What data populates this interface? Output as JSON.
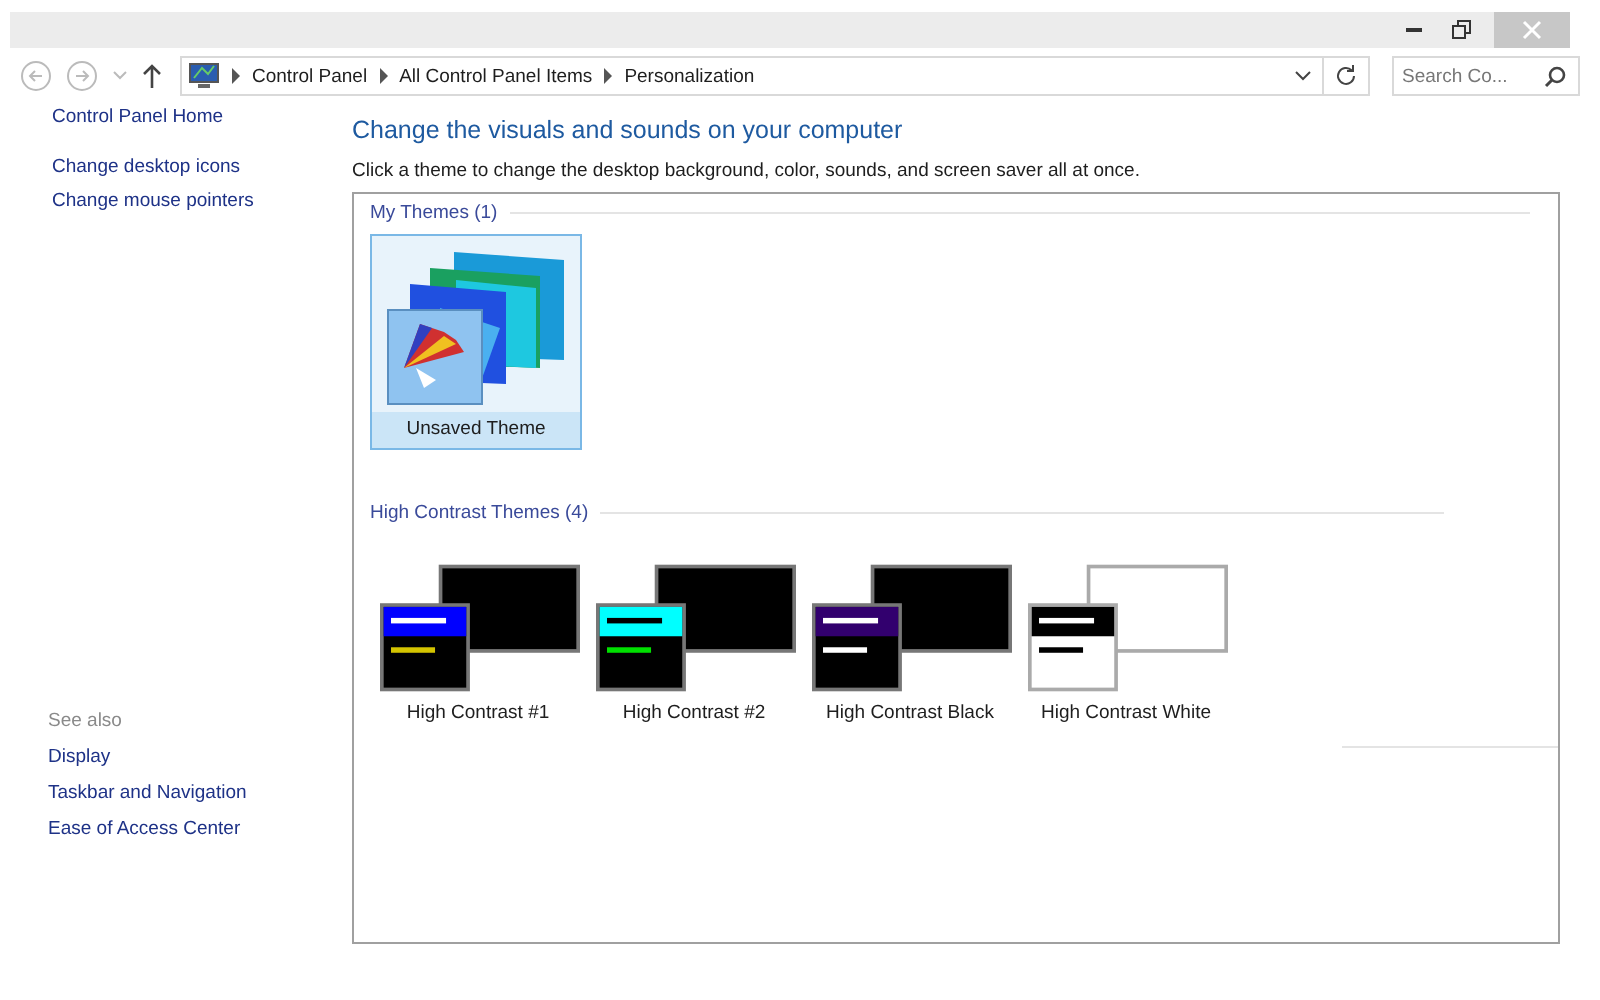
{
  "address_bar": {
    "breadcrumbs": [
      "Control Panel",
      "All Control Panel Items",
      "Personalization"
    ]
  },
  "search": {
    "placeholder": "Search Co..."
  },
  "sidebar": {
    "links": [
      "Control Panel Home",
      "Change desktop icons",
      "Change mouse pointers"
    ],
    "see_also": {
      "title": "See also",
      "links": [
        "Display",
        "Taskbar and Navigation",
        "Ease of Access Center"
      ]
    }
  },
  "main": {
    "heading": "Change the visuals and sounds on your computer",
    "description": "Click a theme to change the desktop background, color, sounds, and screen saver all at once.",
    "groups": [
      {
        "title": "My Themes (1)",
        "kind": "custom",
        "themes": [
          {
            "label": "Unsaved Theme",
            "selected": true
          }
        ]
      },
      {
        "title": "High Contrast Themes (4)",
        "kind": "contrast",
        "themes": [
          {
            "label": "High Contrast #1",
            "selected": false,
            "kind": "hc1"
          },
          {
            "label": "High Contrast #2",
            "selected": false,
            "kind": "hc2"
          },
          {
            "label": "High Contrast Black",
            "selected": false,
            "kind": "black"
          },
          {
            "label": "High Contrast White",
            "selected": false,
            "kind": "white"
          }
        ]
      }
    ]
  }
}
